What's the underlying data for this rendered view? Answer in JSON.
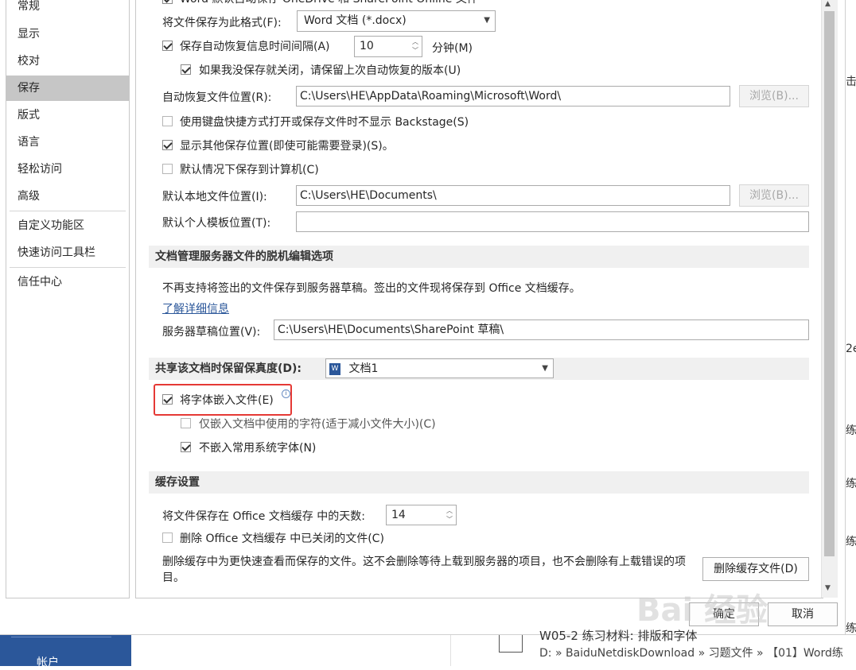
{
  "nav": {
    "items": [
      "常规",
      "显示",
      "校对",
      "保存",
      "版式",
      "语言",
      "轻松访问",
      "高级"
    ],
    "items2": [
      "自定义功能区",
      "快速访问工具栏"
    ],
    "items3": [
      "信任中心"
    ],
    "selected": "保存"
  },
  "save": {
    "top_partial_text": "Word 默认自动保存 OneDrive 和 SharePoint Online 文件",
    "format_label": "将文件保存为此格式(F):",
    "format_value": "Word 文档 (*.docx)",
    "autorecover_label": "保存自动恢复信息时间间隔(A)",
    "autorecover_value": "10",
    "minutes_label": "分钟(M)",
    "keep_last_label": "如果我没保存就关闭，请保留上次自动恢复的版本(U)",
    "autorecover_location_label": "自动恢复文件位置(R):",
    "autorecover_location_value": "C:\\Users\\HE\\AppData\\Roaming\\Microsoft\\Word\\",
    "browse_label": "浏览(B)...",
    "no_backstage_label": "使用键盘快捷方式打开或保存文件时不显示 Backstage(S)",
    "show_other_label": "显示其他保存位置(即使可能需要登录)(S)。",
    "save_to_computer_label": "默认情况下保存到计算机(C)",
    "default_local_label": "默认本地文件位置(I):",
    "default_local_value": "C:\\Users\\HE\\Documents\\",
    "default_template_label": "默认个人模板位置(T):",
    "default_template_value": ""
  },
  "offline": {
    "section_title": "文档管理服务器文件的脱机编辑选项",
    "description": "不再支持将签出的文件保存到服务器草稿。签出的文件现将保存到 Office 文档缓存。",
    "learn_more": "了解详细信息",
    "drafts_label": "服务器草稿位置(V):",
    "drafts_value": "C:\\Users\\HE\\Documents\\SharePoint 草稿\\"
  },
  "fidelity": {
    "section_title": "共享该文档时保留保真度(D):",
    "document_value": "文档1",
    "embed_fonts_label": "将字体嵌入文件(E)",
    "embed_used_label": "仅嵌入文档中使用的字符(适于减小文件大小)(C)",
    "no_common_label": "不嵌入常用系统字体(N)"
  },
  "cache": {
    "section_title": "缓存设置",
    "days_label": "将文件保存在 Office 文档缓存 中的天数:",
    "days_value": "14",
    "delete_closed_label": "删除 Office 文档缓存 中已关闭的文件(C)",
    "note": "删除缓存中为更快速查看而保存的文件。这不会删除等待上载到服务器的项目，也不会删除有上载错误的项目。",
    "delete_button": "删除缓存文件(D)"
  },
  "footer": {
    "ok": "确定",
    "cancel": "取消"
  },
  "background": {
    "account_label": "帐户",
    "file_title": "W05-2 练习材料: 排版和字体",
    "file_path": "D: » BaiduNetdiskDownload » 习题文件 » 【01】Word练",
    "right_edge_fragments": [
      "击",
      "2e",
      "练",
      "练",
      "练",
      "练",
      "]",
      "练"
    ]
  },
  "watermark": "Bai 经验"
}
